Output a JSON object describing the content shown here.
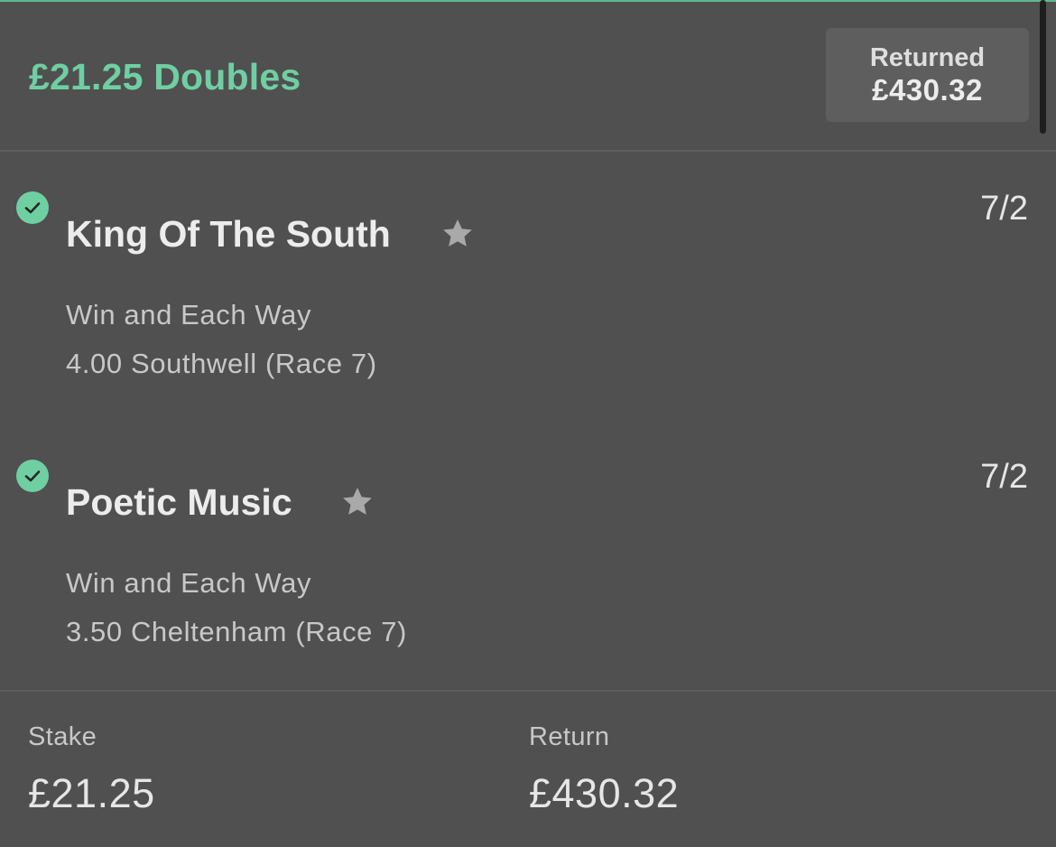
{
  "header": {
    "title": "£21.25 Doubles",
    "returned_label": "Returned",
    "returned_amount": "£430.32"
  },
  "selections": [
    {
      "name": "King Of The South",
      "odds": "7/2",
      "market": "Win and Each Way",
      "event": "4.00 Southwell (Race 7)",
      "status": "won"
    },
    {
      "name": "Poetic Music",
      "odds": "7/2",
      "market": "Win and Each Way",
      "event": "3.50 Cheltenham (Race 7)",
      "status": "won"
    }
  ],
  "footer": {
    "stake_label": "Stake",
    "stake_value": "£21.25",
    "return_label": "Return",
    "return_value": "£430.32"
  },
  "colors": {
    "background": "#505050",
    "accent_green": "#6fcfa3",
    "text_primary": "#ececec",
    "text_secondary": "#c8c8c8"
  }
}
